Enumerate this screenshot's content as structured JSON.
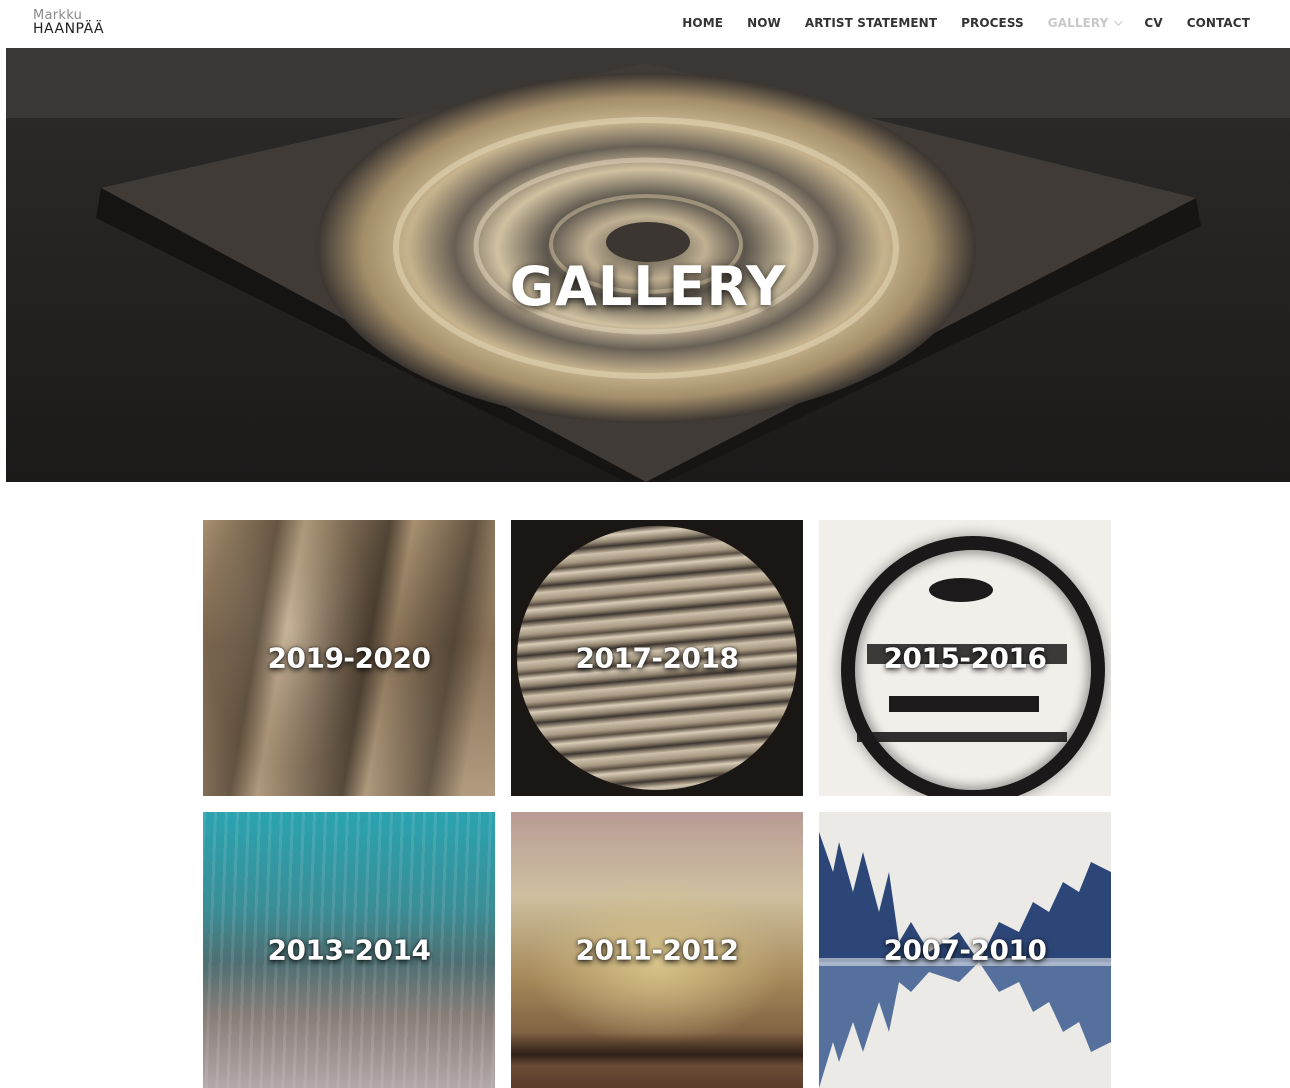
{
  "logo": {
    "first_name": "Markku",
    "last_name": "HAANPÄÄ"
  },
  "nav": {
    "items": [
      {
        "label": "HOME",
        "active": false
      },
      {
        "label": "NOW",
        "active": false
      },
      {
        "label": "ARTIST STATEMENT",
        "active": false
      },
      {
        "label": "PROCESS",
        "active": false
      },
      {
        "label": "GALLERY",
        "active": true,
        "has_dropdown": true,
        "icon": "chevron-down-icon"
      },
      {
        "label": "CV",
        "active": false
      },
      {
        "label": "CONTACT",
        "active": false
      }
    ]
  },
  "hero": {
    "title": "GALLERY"
  },
  "gallery": {
    "tiles": [
      {
        "label": "2019-2020"
      },
      {
        "label": "2017-2018"
      },
      {
        "label": "2015-2016"
      },
      {
        "label": "2013-2014"
      },
      {
        "label": "2011-2012"
      },
      {
        "label": "2007-2010"
      }
    ]
  },
  "colors": {
    "nav_text": "#333333",
    "nav_active": "#c8c8c8",
    "background": "#ffffff"
  }
}
